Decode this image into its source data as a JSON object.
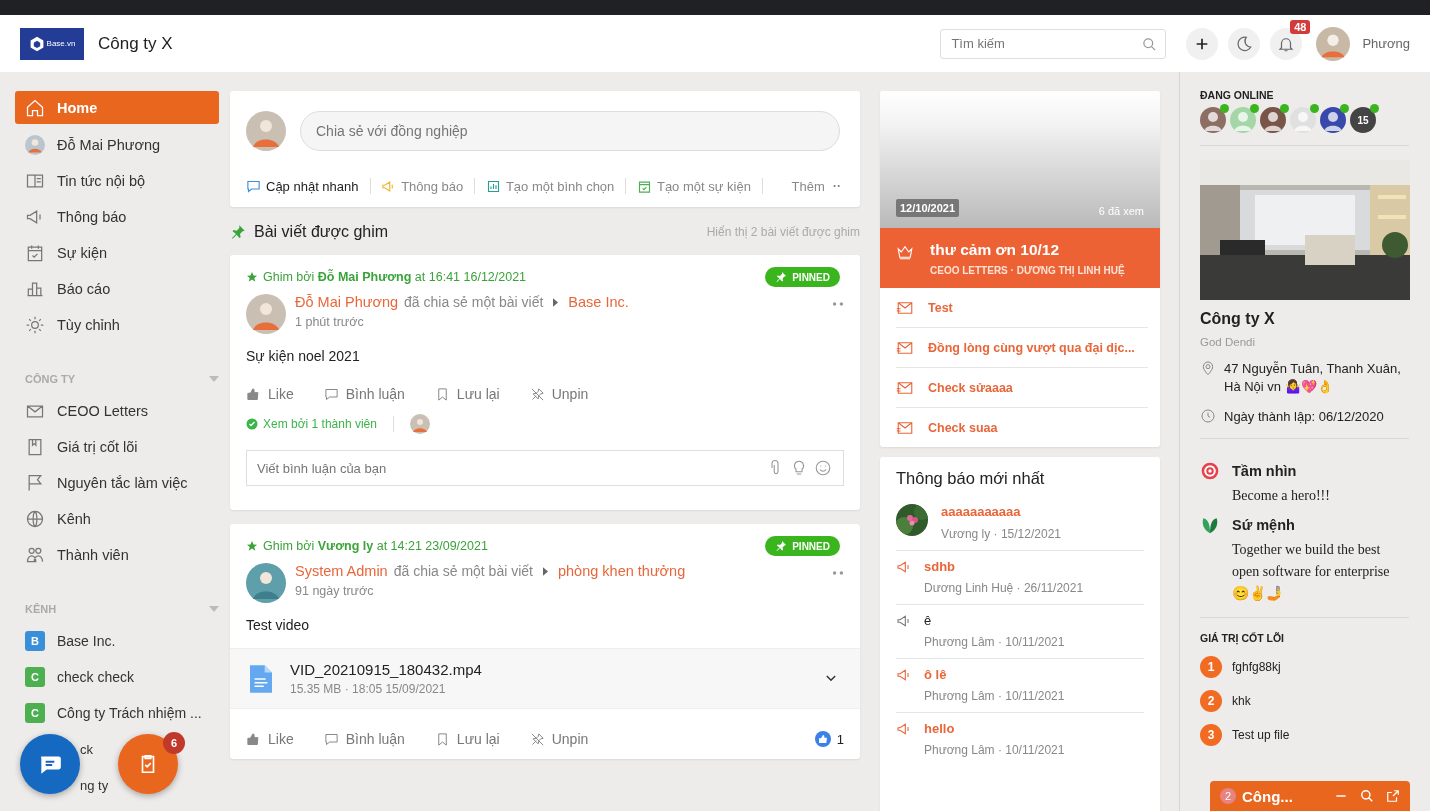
{
  "header": {
    "logo": "Base.vn",
    "company": "Công ty X",
    "search": {
      "placeholder": "Tìm kiếm"
    },
    "notification_count": "48",
    "user": "Phương"
  },
  "sidebar": {
    "nav": [
      {
        "label": "Home",
        "selected": true,
        "kind": "icon"
      },
      {
        "label": "Đỗ Mai Phương",
        "selected": false,
        "kind": "avatar"
      },
      {
        "label": "Tin tức nội bộ",
        "selected": false,
        "kind": "icon"
      },
      {
        "label": "Thông báo",
        "selected": false,
        "kind": "icon"
      },
      {
        "label": "Sự kiện",
        "selected": false,
        "kind": "icon"
      },
      {
        "label": "Báo cáo",
        "selected": false,
        "kind": "icon"
      },
      {
        "label": "Tùy chỉnh",
        "selected": false,
        "kind": "icon"
      }
    ],
    "company_title": "CÔNG TY",
    "company": [
      {
        "label": "CEOO Letters"
      },
      {
        "label": "Giá trị cốt lõi"
      },
      {
        "label": "Nguyên tắc làm việc"
      },
      {
        "label": "Kênh"
      },
      {
        "label": "Thành viên"
      }
    ],
    "channels_title": "KÊNH",
    "channels": [
      {
        "letter": "B",
        "color": "#3a8fd9",
        "label": "Base Inc."
      },
      {
        "letter": "C",
        "color": "#4caf50",
        "label": "check check"
      },
      {
        "letter": "C",
        "color": "#4caf50",
        "label": "Công ty Trách nhiệm ..."
      },
      {
        "covered": true,
        "label": "ck"
      },
      {
        "covered": true,
        "label": "ng ty"
      }
    ]
  },
  "composer": {
    "placeholder": "Chia sẻ với đồng nghiệp",
    "actions": [
      {
        "label": "Cập nhật nhanh",
        "selected": true
      },
      {
        "label": "Thông báo",
        "selected": false
      },
      {
        "label": "Tạo một bình chọn",
        "selected": false
      },
      {
        "label": "Tạo một sự kiện",
        "selected": false
      }
    ],
    "more": "Thêm"
  },
  "pinned": {
    "title": "Bài viết được ghim",
    "summary": "Hiển thị 2 bài viết được ghim"
  },
  "posts": [
    {
      "pinned_by": "Ghim bởi **Đỗ Mai Phương** at 16:41 16/12/2021",
      "badge": "PINNED",
      "author": "Đỗ Mai Phương",
      "verb": "đã chia sẻ một bài viết",
      "target": "Base Inc.",
      "time": "1 phút trước",
      "content": "Sự kiện noel 2021",
      "actions": [
        "Like",
        "Bình luận",
        "Lưu lại",
        "Unpin"
      ],
      "seen_by": "Xem bởi 1 thành viên",
      "comment_placeholder": "Viết bình luận của bạn"
    },
    {
      "pinned_by": "Ghim bởi **Vương ly** at 14:21 23/09/2021",
      "badge": "PINNED",
      "author": "System Admin",
      "verb": "đã chia sẻ một bài viết",
      "target": "phòng khen thưởng",
      "time": "91 ngày trước",
      "content": "Test video",
      "attachment": {
        "name": "VID_20210915_180432.mp4",
        "meta": "15.35 MB · 18:05 15/09/2021"
      },
      "actions": [
        "Like",
        "Bình luận",
        "Lưu lại",
        "Unpin"
      ],
      "like_count": "1"
    }
  ],
  "letters": {
    "date": "12/10/2021",
    "views": "6 đã xem",
    "featured": {
      "title": "thư cảm ơn 10/12",
      "subtitle": "CEOO LETTERS · DƯƠNG THỊ LINH HUỆ"
    },
    "items": [
      "Test",
      "Đồng lòng cùng vượt qua đại dịc...",
      "Check sửaaaa",
      "Check suaa"
    ]
  },
  "notices": {
    "title": "Thông báo mới nhất",
    "items": [
      {
        "title": "aaaaaaaaaaa",
        "meta": "Vương ly · 15/12/2021",
        "unread": true
      },
      {
        "kind": "announcement",
        "title": "sdhb",
        "meta": "Dương Linh Huệ · 26/11/2021",
        "unread": true
      },
      {
        "kind": "announcement",
        "title": "ê",
        "meta": "Phương Lâm · 10/11/2021",
        "unread": false
      },
      {
        "kind": "announcement",
        "title": "ô lê",
        "meta": "Phương Lâm · 10/11/2021",
        "unread": true
      },
      {
        "kind": "announcement",
        "title": "hello",
        "meta": "Phương Lâm · 10/11/2021",
        "unread": true
      }
    ]
  },
  "profile": {
    "online_title": "ĐANG ONLINE",
    "online_more": "15",
    "name": "Công ty X",
    "subtitle": "God Dendi",
    "address": "47 Nguyễn Tuân, Thanh Xuân, Hà Nội vn 🤷‍♀️💖👌",
    "founded": "Ngày thành lập: 06/12/2020",
    "vision_title": "Tầm nhìn",
    "vision": "Become a hero!!!",
    "mission_title": "Sứ mệnh",
    "mission": "Together we build the best open software for enterprise 😊✌🤳",
    "values_title": "GIÁ TRỊ CỐT LÕI",
    "values": [
      {
        "num": "1",
        "label": "fghfg88kj"
      },
      {
        "num": "2",
        "label": "khk"
      },
      {
        "num": "3",
        "label": "Test up file"
      }
    ]
  },
  "task_badge": "6",
  "chat": {
    "count": "2",
    "title": "Công..."
  }
}
